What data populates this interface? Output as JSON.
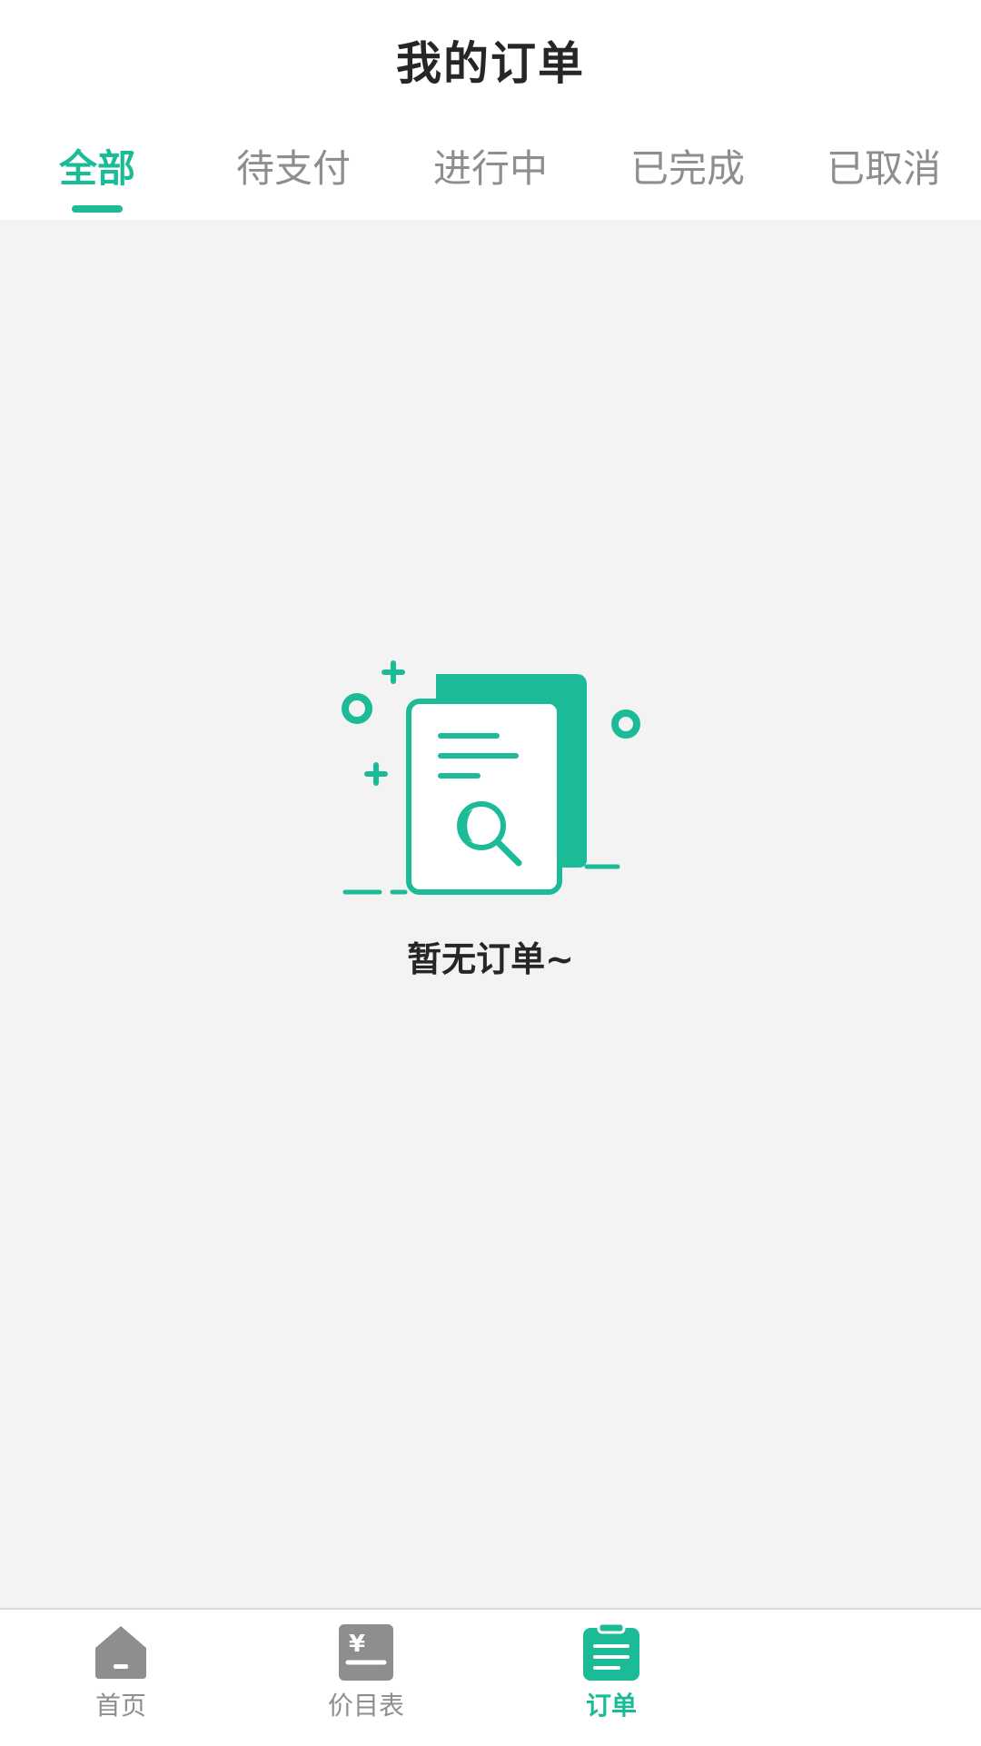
{
  "header": {
    "title": "我的订单"
  },
  "tabs": [
    {
      "label": "全部",
      "active": true
    },
    {
      "label": "待支付",
      "active": false
    },
    {
      "label": "进行中",
      "active": false
    },
    {
      "label": "已完成",
      "active": false
    },
    {
      "label": "已取消",
      "active": false
    }
  ],
  "empty_state": {
    "icon": "document-search-icon",
    "message": "暂无订单~"
  },
  "tabbar": {
    "items": [
      {
        "label": "首页",
        "icon": "home-icon",
        "active": false
      },
      {
        "label": "价目表",
        "icon": "price-list-icon",
        "active": false
      },
      {
        "label": "订单",
        "icon": "orders-icon",
        "active": true
      }
    ]
  },
  "colors": {
    "accent": "#1cbb98",
    "inactive": "#8e8e8e",
    "background": "#f3f3f3",
    "text": "#262626"
  }
}
